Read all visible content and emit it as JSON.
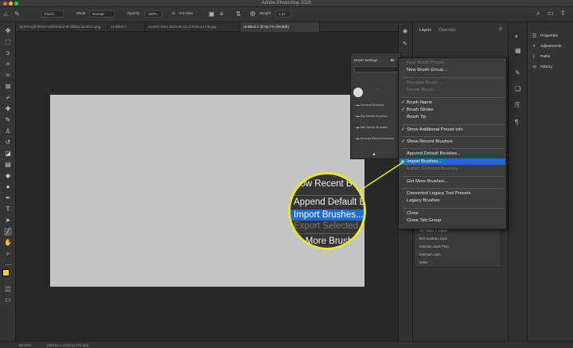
{
  "window": {
    "title": "Adobe Photoshop 2020"
  },
  "options_bar": {
    "mode_label": "Mode:",
    "mode_value": "Normal",
    "opacity_label": "Opacity:",
    "opacity_value": "100%",
    "flow_label": "Flow:",
    "flow_value": "100%",
    "preset_value": "Pixels",
    "antialias_label": "Anti-alias",
    "weight_label": "Weight:",
    "weight_value": "1 px"
  },
  "tabs": [
    {
      "label": "dp1PKn(df-9k9c0-s2bf4e0bd-8f-d8d61cbc9021.png"
    },
    {
      "label": "Untitled-1"
    },
    {
      "label": "Screen Shot 2020-06-22 at 8.53.44 PM.jpg"
    },
    {
      "label": "Untitled-2 @ 66.7% (RGB/8)"
    }
  ],
  "status": {
    "zoom": "66.67%",
    "doc": "1260 px x 1440 px (72 ppi)"
  },
  "layers_panel": {
    "tab_layers": "Layers",
    "tab_channels": "Channels"
  },
  "props_panel": {
    "items": [
      {
        "label": "Properties",
        "icon": "properties-icon"
      },
      {
        "label": "Adjustments",
        "icon": "adjustments-icon"
      },
      {
        "label": "Paths",
        "icon": "paths-icon"
      },
      {
        "label": "History",
        "icon": "history-icon"
      }
    ]
  },
  "brush_panel": {
    "tab_settings": "Brush Settings",
    "tab_brushes": "Br",
    "folders": [
      "General Brushes",
      "Dry Media Brushes",
      "Wet Media Brushes",
      "Special Effects Brushes"
    ]
  },
  "context_menu": {
    "items": [
      {
        "label": "New Brush Preset...",
        "state": "disabled"
      },
      {
        "label": "New Brush Group...",
        "state": "enabled"
      },
      {
        "label": "Rename Brush...",
        "state": "disabled"
      },
      {
        "label": "Delete Brush...",
        "state": "disabled"
      },
      {
        "label": "Brush Name",
        "state": "checked"
      },
      {
        "label": "Brush Stroke",
        "state": "checked"
      },
      {
        "label": "Brush Tip",
        "state": "enabled"
      },
      {
        "label": "Show Additional Preset Info",
        "state": "checked"
      },
      {
        "label": "Show Recent Brushes",
        "state": "checked"
      },
      {
        "label": "Append Default Brushes...",
        "state": "enabled"
      },
      {
        "label": "Import Brushes...",
        "state": "highlighted"
      },
      {
        "label": "Export Selected Brushes...",
        "state": "disabled"
      },
      {
        "label": "Get More Brushes...",
        "state": "enabled"
      },
      {
        "label": "Converted Legacy Tool Presets",
        "state": "enabled"
      },
      {
        "label": "Legacy Brushes",
        "state": "enabled"
      },
      {
        "label": "Close",
        "state": "enabled"
      },
      {
        "label": "Close Tab Group",
        "state": "enabled"
      }
    ]
  },
  "below_list": {
    "items": [
      "DIY Wacs 1 Vugon",
      "IKO Scalina Loops",
      "Internat Loops Prep",
      "Internal Loops",
      "Index"
    ]
  },
  "zoom": {
    "line1": "how Recent B",
    "line2": "Append Default B",
    "line3": "Import Brushes...",
    "line4": "Export Selected B",
    "line5": "et More Brush",
    "accent_color": "#e6e43c",
    "highlight_color": "#1f6bd1"
  }
}
